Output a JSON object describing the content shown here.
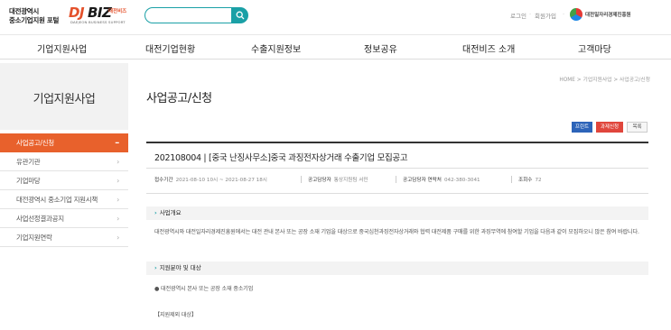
{
  "header": {
    "org_name_line1": "대전광역시",
    "org_name_line2": "중소기업지원 포털",
    "logo_dj": "DJ",
    "logo_biz": "BIZ",
    "logo_daejeon": "대전비즈",
    "logo_sub": "DAEJEON BUSINESS SUPPORT",
    "search": {
      "placeholder": "",
      "value": "",
      "icon": "search-icon"
    },
    "util_links": [
      "로그인",
      "회원가입"
    ],
    "org_logo_text": "대전일자리경제진흥원"
  },
  "gnb": {
    "items": [
      "기업지원사업",
      "대전기업현황",
      "수출지원정보",
      "정보공유",
      "대전비즈 소개",
      "고객마당"
    ]
  },
  "lnb": {
    "title": "기업지원사업",
    "items": [
      {
        "label": "사업공고/신청",
        "active": true,
        "icon": "minus-icon"
      },
      {
        "label": "유관기관",
        "active": false,
        "icon": "chevron-right-icon"
      },
      {
        "label": "기업마당",
        "active": false,
        "icon": "chevron-right-icon"
      },
      {
        "label": "대전광역시 중소기업 지원시책",
        "active": false,
        "icon": "chevron-right-icon"
      },
      {
        "label": "사업선정결과공지",
        "active": false,
        "icon": "chevron-right-icon"
      },
      {
        "label": "기업지원연락",
        "active": false,
        "icon": "chevron-right-icon"
      }
    ],
    "active_color": "#e8612c"
  },
  "main": {
    "breadcrumb": "HOME > 기업지원사업 > 사업공고/신청",
    "page_title": "사업공고/신청",
    "buttons": {
      "print": "프린트",
      "apply": "과제신청",
      "list": "목록"
    },
    "post": {
      "title": "202108004 | [중국 난징사무소]중국 과징전자상거래 수출기업 모집공고",
      "meta": {
        "period_label": "접수기간",
        "period_value": "2021-08-10 10시 ~ 2021-08-27 18시",
        "manager_label": "공고담당자",
        "manager_value": "통상지원팀 서민",
        "contact_label": "공고담당자 연락처",
        "contact_value": "042-380-3041",
        "views_label": "조회수",
        "views_value": "72"
      }
    },
    "sections": [
      {
        "heading": "사업개요",
        "text": "대전광역시와 대전일자리경제진흥원에서는 대전 관내 본사 또는 공장 소재 기업을 대상으로 중국심천과징전자상거래와 협력 대전제품 구매를 위한 과징무역에 참여할 기업을 다음과 같이 모집하오니 많은 참여 바랍니다."
      },
      {
        "heading": "지원분야 및 대상",
        "item": "● 대전광역시 본사 또는 공장 소재 중소기업",
        "note": "【지원제외 대상】"
      }
    ]
  },
  "colors": {
    "accent_teal": "#1aa0a6",
    "print_blue": "#2d64b9",
    "apply_red": "#e0463c",
    "brand_orange": "#e4512b"
  }
}
